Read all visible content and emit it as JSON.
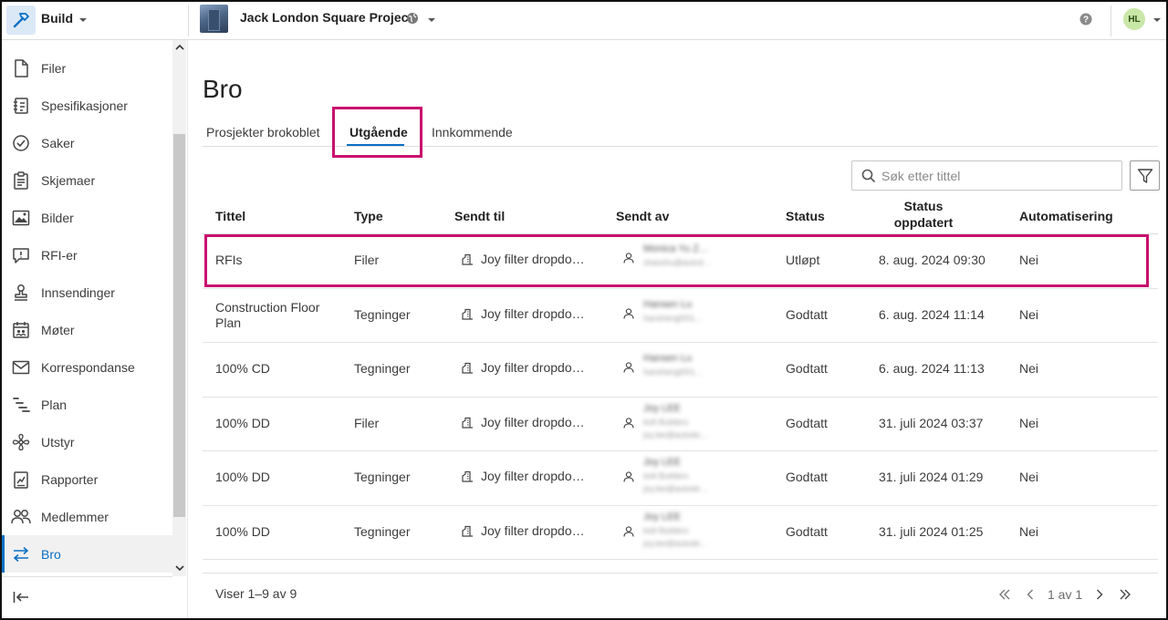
{
  "app": {
    "name": "Build"
  },
  "project": {
    "name": "Jack London Square Project"
  },
  "user": {
    "initials": "HL"
  },
  "sidebar": {
    "items": [
      {
        "label": "Filer",
        "icon": "file-icon"
      },
      {
        "label": "Spesifikasjoner",
        "icon": "specifications-icon"
      },
      {
        "label": "Saker",
        "icon": "issues-check-icon"
      },
      {
        "label": "Skjemaer",
        "icon": "forms-clipboard-icon"
      },
      {
        "label": "Bilder",
        "icon": "photos-icon"
      },
      {
        "label": "RFI-er",
        "icon": "rfi-chat-icon"
      },
      {
        "label": "Innsendinger",
        "icon": "submittals-stamp-icon"
      },
      {
        "label": "Møter",
        "icon": "meetings-calendar-icon"
      },
      {
        "label": "Korrespondanse",
        "icon": "correspondence-mail-icon"
      },
      {
        "label": "Plan",
        "icon": "schedule-plan-icon"
      },
      {
        "label": "Utstyr",
        "icon": "assets-fan-icon"
      },
      {
        "label": "Rapporter",
        "icon": "reports-icon"
      },
      {
        "label": "Medlemmer",
        "icon": "members-icon"
      },
      {
        "label": "Bro",
        "icon": "bridge-arrows-icon",
        "active": true
      }
    ]
  },
  "page": {
    "title": "Bro",
    "tabs": [
      {
        "label": "Prosjekter brokoblet"
      },
      {
        "label": "Utgående",
        "active": true
      },
      {
        "label": "Innkommende"
      }
    ],
    "search": {
      "placeholder": "Søk etter tittel"
    }
  },
  "table": {
    "headers": {
      "tittel": "Tittel",
      "type": "Type",
      "sendt_til": "Sendt til",
      "sendt_av": "Sendt av",
      "status": "Status",
      "status_oppdatert_1": "Status",
      "status_oppdatert_2": "oppdatert",
      "automatisering": "Automatisering"
    },
    "rows": [
      {
        "tittel": "RFIs",
        "type": "Filer",
        "sendt_til": "Joy filter dropdo…",
        "sendt_av_name": "Monica Yu Z…",
        "sendt_av_line2": "shaoshu@autod…",
        "sendt_av_line3": "",
        "status": "Utløpt",
        "oppdatert": "8. aug. 2024 09:30",
        "automatisering": "Nei"
      },
      {
        "tittel": "Construction Floor Plan",
        "type": "Tegninger",
        "sendt_til": "Joy filter dropdo…",
        "sendt_av_name": "Hansen Lu",
        "sendt_av_line2": "hanshengl001…",
        "sendt_av_line3": "",
        "status": "Godtatt",
        "oppdatert": "6. aug. 2024 11:14",
        "automatisering": "Nei"
      },
      {
        "tittel": "100% CD",
        "type": "Tegninger",
        "sendt_til": "Joy filter dropdo…",
        "sendt_av_name": "Hansen Lu",
        "sendt_av_line2": "hanshengl001…",
        "sendt_av_line3": "",
        "status": "Godtatt",
        "oppdatert": "6. aug. 2024 11:13",
        "automatisering": "Nei"
      },
      {
        "tittel": "100% DD",
        "type": "Filer",
        "sendt_til": "Joy filter dropdo…",
        "sendt_av_name": "Joy LEE",
        "sendt_av_line2": "bolt Builders",
        "sendt_av_line3": "joy.lee@autode…",
        "status": "Godtatt",
        "oppdatert": "31. juli 2024 03:37",
        "automatisering": "Nei"
      },
      {
        "tittel": "100% DD",
        "type": "Tegninger",
        "sendt_til": "Joy filter dropdo…",
        "sendt_av_name": "Joy LEE",
        "sendt_av_line2": "bolt Builders",
        "sendt_av_line3": "joy.lee@autode…",
        "status": "Godtatt",
        "oppdatert": "31. juli 2024 01:29",
        "automatisering": "Nei"
      },
      {
        "tittel": "100% DD",
        "type": "Tegninger",
        "sendt_til": "Joy filter dropdo…",
        "sendt_av_name": "Joy LEE",
        "sendt_av_line2": "bolt Builders",
        "sendt_av_line3": "joy.lee@autode…",
        "status": "Godtatt",
        "oppdatert": "31. juli 2024 01:25",
        "automatisering": "Nei"
      }
    ]
  },
  "footer": {
    "showing_prefix": "Viser 1–9 av",
    "showing_total": "9",
    "page_label": "1 av 1"
  },
  "colors": {
    "accent": "#0a70c4",
    "highlight": "#c8106e"
  }
}
